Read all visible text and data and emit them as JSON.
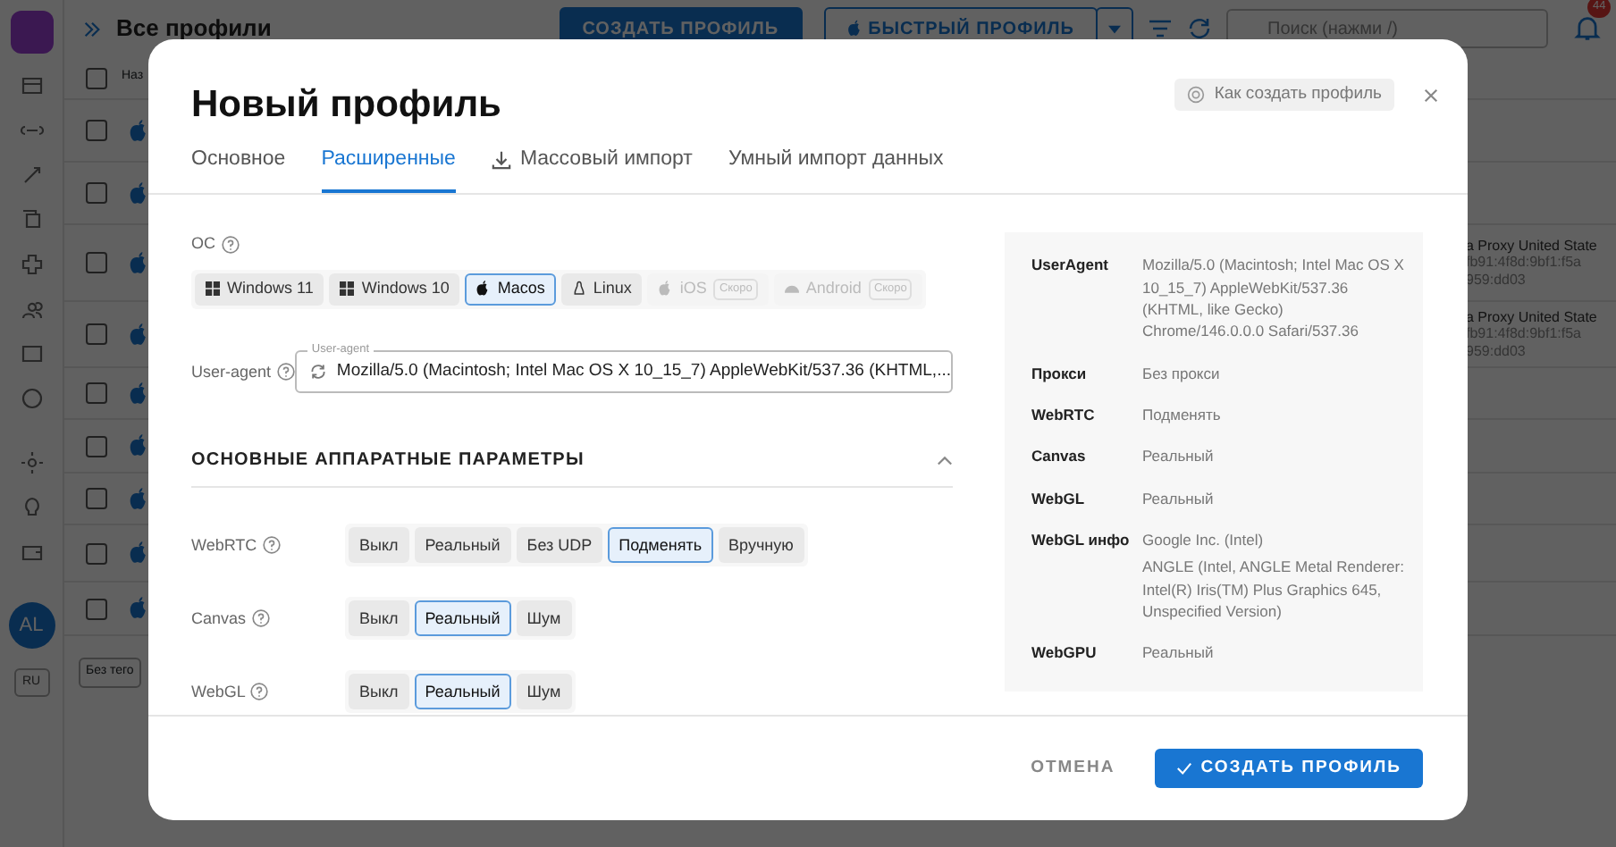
{
  "app": {
    "title": "Все профили",
    "create_button": "СОЗДАТЬ ПРОФИЛЬ",
    "quick_button": "БЫСТРЫЙ ПРОФИЛЬ",
    "search_placeholder": "Поиск (нажми /)",
    "notification_count": "44",
    "column_header": "Наз",
    "header_checked": false,
    "avatar": "AL",
    "language": "RU",
    "tag_filter": "Без тего",
    "rows": [
      {
        "checked": false
      },
      {
        "checked": false
      },
      {
        "checked": false,
        "proxy": "a Proxy United State",
        "ip": [
          "fb91:4f8d:9bf1:f5a",
          "959:dd03"
        ]
      },
      {
        "checked": false,
        "proxy": "a Proxy United State",
        "ip": [
          "fb91:4f8d:9bf1:f5a",
          "959:dd03"
        ]
      },
      {
        "checked": false
      },
      {
        "checked": false
      },
      {
        "checked": false
      },
      {
        "checked": false
      },
      {
        "checked": false
      }
    ]
  },
  "modal": {
    "title": "Новый профиль",
    "help_button": "Как создать профиль",
    "tabs": [
      {
        "label": "Основное",
        "selected": false
      },
      {
        "label": "Расширенные",
        "selected": true
      },
      {
        "label": "Массовый импорт",
        "selected": false,
        "kind": "download"
      },
      {
        "label": "Умный импорт данных",
        "selected": false
      }
    ],
    "os": {
      "label": "ОС",
      "options": [
        {
          "label": "Windows 11",
          "kind": "windows",
          "selected": false,
          "disabled": false
        },
        {
          "label": "Windows 10",
          "kind": "windows",
          "selected": false,
          "disabled": false
        },
        {
          "label": "Macos",
          "kind": "apple",
          "selected": true,
          "disabled": false
        },
        {
          "label": "Linux",
          "kind": "linux",
          "selected": false,
          "disabled": false
        },
        {
          "label": "iOS",
          "kind": "apple",
          "selected": false,
          "disabled": true,
          "badge": "Скоро"
        },
        {
          "label": "Android",
          "kind": "android",
          "selected": false,
          "disabled": true,
          "badge": "Скоро"
        }
      ]
    },
    "user_agent": {
      "label": "User-agent",
      "floating_label": "User-agent",
      "value": "Mozilla/5.0 (Macintosh; Intel Mac OS X 10_15_7) AppleWebKit/537.36 (KHTML,..."
    },
    "section": {
      "title": "ОСНОВНЫЕ АППАРАТНЫЕ ПАРАМЕТРЫ",
      "expanded": true
    },
    "params": [
      {
        "label": "WebRTC",
        "options": [
          {
            "label": "Выкл",
            "selected": false
          },
          {
            "label": "Реальный",
            "selected": false
          },
          {
            "label": "Без UDP",
            "selected": false
          },
          {
            "label": "Подменять",
            "selected": true
          },
          {
            "label": "Вручную",
            "selected": false
          }
        ]
      },
      {
        "label": "Canvas",
        "options": [
          {
            "label": "Выкл",
            "selected": false
          },
          {
            "label": "Реальный",
            "selected": true
          },
          {
            "label": "Шум",
            "selected": false
          }
        ]
      },
      {
        "label": "WebGL",
        "options": [
          {
            "label": "Выкл",
            "selected": false
          },
          {
            "label": "Реальный",
            "selected": true
          },
          {
            "label": "Шум",
            "selected": false
          }
        ]
      }
    ],
    "summary": [
      {
        "label": "UserAgent",
        "values": [
          "Mozilla/5.0 (Macintosh; Intel Mac OS X 10_15_7) AppleWebKit/537.36 (KHTML, like Gecko) Chrome/146.0.0.0 Safari/537.36"
        ]
      },
      {
        "label": "Прокси",
        "values": [
          "Без прокси"
        ]
      },
      {
        "label": "WebRTC",
        "values": [
          "Подменять"
        ]
      },
      {
        "label": "Canvas",
        "values": [
          "Реальный"
        ]
      },
      {
        "label": "WebGL",
        "values": [
          "Реальный"
        ]
      },
      {
        "label": "WebGL инфо",
        "values": [
          "Google Inc. (Intel)",
          "ANGLE (Intel, ANGLE Metal Renderer: Intel(R) Iris(TM) Plus Graphics 645, Unspecified Version)"
        ]
      },
      {
        "label": "WebGPU",
        "values": [
          "Реальный"
        ]
      }
    ],
    "cancel_button": "ОТМЕНА",
    "submit_button": "СОЗДАТЬ ПРОФИЛЬ"
  }
}
